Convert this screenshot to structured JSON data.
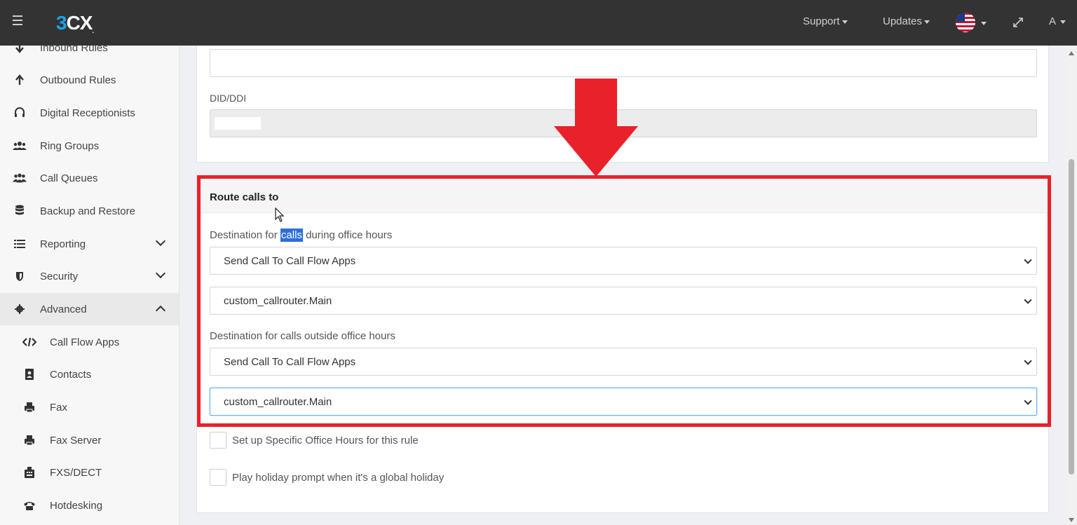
{
  "topbar": {
    "logo_three": "3",
    "logo_cx": "CX",
    "logo_mark": ".",
    "support": "Support",
    "updates": "Updates",
    "user": "A"
  },
  "sidebar": {
    "items": [
      {
        "label": "Inbound Rules",
        "icon": "arrow-down-icon"
      },
      {
        "label": "Outbound Rules",
        "icon": "arrow-up-icon"
      },
      {
        "label": "Digital Receptionists",
        "icon": "headset-icon"
      },
      {
        "label": "Ring Groups",
        "icon": "users-icon"
      },
      {
        "label": "Call Queues",
        "icon": "group-icon"
      },
      {
        "label": "Backup and Restore",
        "icon": "database-icon"
      },
      {
        "label": "Reporting",
        "icon": "list-icon"
      },
      {
        "label": "Security",
        "icon": "shield-icon"
      },
      {
        "label": "Advanced",
        "icon": "gear-icon"
      },
      {
        "label": "Call Flow Apps",
        "icon": "code-icon"
      },
      {
        "label": "Contacts",
        "icon": "contact-book-icon"
      },
      {
        "label": "Fax",
        "icon": "fax-icon"
      },
      {
        "label": "Fax Server",
        "icon": "fax-icon"
      },
      {
        "label": "FXS/DECT",
        "icon": "fxs-device-icon"
      },
      {
        "label": "Hotdesking",
        "icon": "phone-icon"
      }
    ]
  },
  "form": {
    "did_label": "DID/DDI",
    "route_title": "Route calls to",
    "office_label_pre": "Destination for ",
    "office_label_hl": "calls",
    "office_label_post": " during office hours",
    "office_dest_type": "Send Call To Call Flow Apps",
    "office_dest_app": "custom_callrouter.Main",
    "outside_label": "Destination for calls outside office hours",
    "outside_dest_type": "Send Call To Call Flow Apps",
    "outside_dest_app": "custom_callrouter.Main",
    "specific_hours_label": "Set up Specific Office Hours for this rule",
    "holiday_label": "Play holiday prompt when it's a global holiday"
  },
  "colors": {
    "annotation_red": "#e8212b",
    "topbar_bg": "#333333",
    "logo_blue": "#1aa3e8",
    "highlight_blue": "#2e6fd6"
  }
}
